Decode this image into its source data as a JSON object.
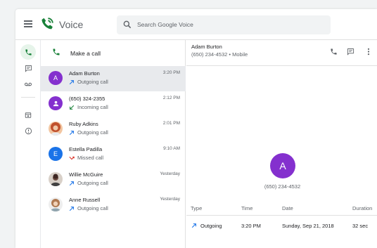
{
  "header": {
    "app_title": "Voice",
    "search_placeholder": "Search Google Voice"
  },
  "list": {
    "make_call_label": "Make a call",
    "items": [
      {
        "name": "Adam Burton",
        "status": "Outgoing call",
        "time": "3:20 PM",
        "avatar_letter": "A",
        "avatar_color": "#8430ce",
        "status_type": "outgoing"
      },
      {
        "name": "(650) 324-2355",
        "status": "Incoming call",
        "time": "2:12 PM",
        "avatar_letter": "",
        "avatar_color": "#8430ce",
        "status_type": "incoming"
      },
      {
        "name": "Ruby Adkins",
        "status": "Outgoing call",
        "time": "2:01 PM",
        "avatar_letter": "",
        "avatar_color": "#d37a4a",
        "status_type": "outgoing"
      },
      {
        "name": "Estella Padilla",
        "status": "Missed call",
        "time": "9:10 AM",
        "avatar_letter": "E",
        "avatar_color": "#1a73e8",
        "status_type": "missed"
      },
      {
        "name": "Willie McGuire",
        "status": "Outgoing call",
        "time": "Yesterday",
        "avatar_letter": "",
        "avatar_color": "#5d4037",
        "status_type": "outgoing"
      },
      {
        "name": "Anne Russell",
        "status": "Outgoing call",
        "time": "Yesterday",
        "avatar_letter": "",
        "avatar_color": "#c9a27e",
        "status_type": "outgoing"
      }
    ]
  },
  "detail": {
    "name": "Adam Burton",
    "subtitle": "(650) 234-4532 • Mobile",
    "avatar_letter": "A",
    "number": "(650) 234-4532",
    "table": {
      "headers": [
        "Type",
        "Time",
        "Date",
        "Duration"
      ],
      "row": [
        "Outgoing",
        "3:20 PM",
        "Sunday, Sep 21, 2018",
        "32 sec"
      ]
    }
  },
  "colors": {
    "accent_green": "#188038",
    "outgoing": "#1a73e8",
    "incoming": "#188038",
    "missed": "#d93025",
    "selected_row": "#e8eaed"
  },
  "icons": {
    "rail": [
      "calls-icon",
      "messages-icon",
      "voicemail-icon",
      "archive-icon",
      "info-icon"
    ],
    "detail_actions": [
      "phone-icon",
      "message-icon",
      "more-vert-icon"
    ]
  }
}
